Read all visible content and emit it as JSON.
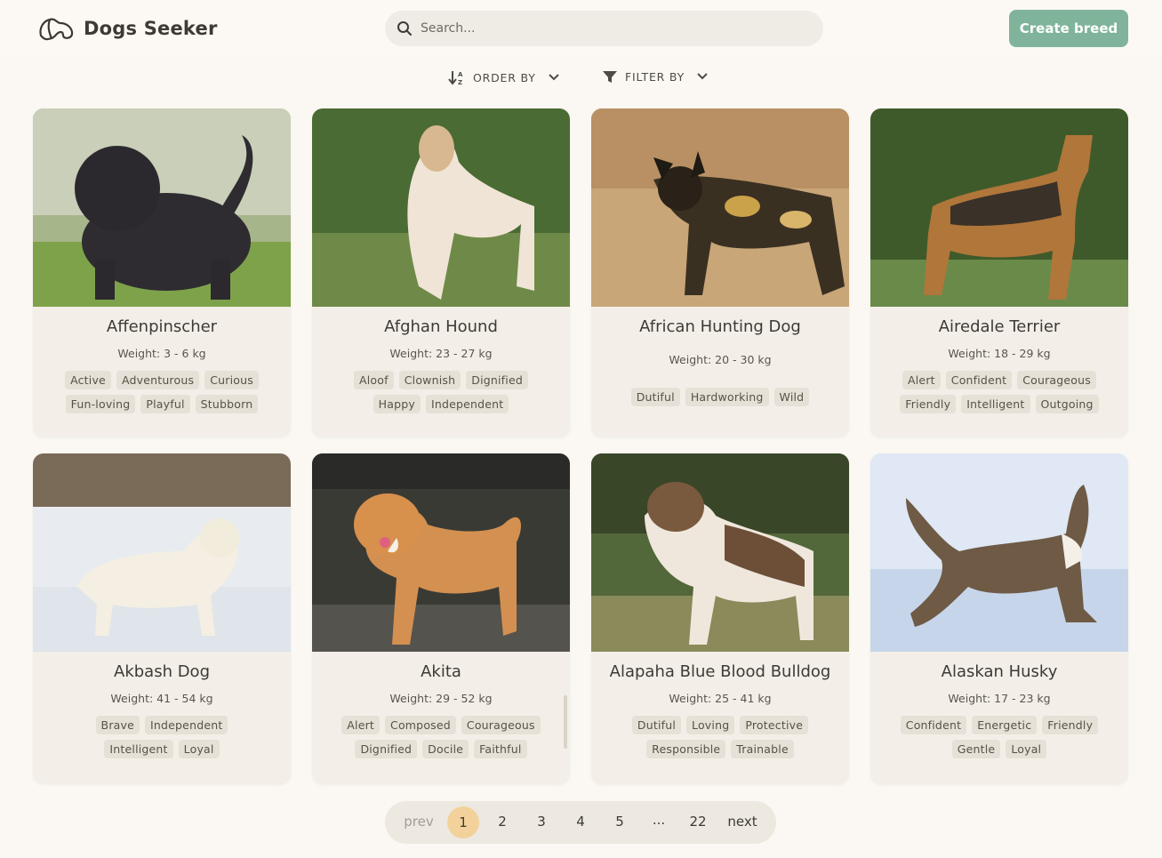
{
  "app": {
    "title": "Dogs Seeker",
    "create_label": "Create breed",
    "accent": "#7fb49a"
  },
  "search": {
    "placeholder": "Search..."
  },
  "toolbar": {
    "order_label": "ORDER BY",
    "filter_label": "FILTER BY"
  },
  "dogs": [
    {
      "name": "Affenpinscher",
      "weight": "Weight: 3 - 6 kg",
      "tags": [
        "Active",
        "Adventurous",
        "Curious",
        "Fun-loving",
        "Playful",
        "Stubborn"
      ]
    },
    {
      "name": "Afghan Hound",
      "weight": "Weight: 23 - 27 kg",
      "tags": [
        "Aloof",
        "Clownish",
        "Dignified",
        "Happy",
        "Independent"
      ]
    },
    {
      "name": "African Hunting Dog",
      "weight": "Weight: 20 - 30 kg",
      "tags": [
        "Dutiful",
        "Hardworking",
        "Wild"
      ]
    },
    {
      "name": "Airedale Terrier",
      "weight": "Weight: 18 - 29 kg",
      "tags": [
        "Alert",
        "Confident",
        "Courageous",
        "Friendly",
        "Intelligent",
        "Outgoing"
      ]
    },
    {
      "name": "Akbash Dog",
      "weight": "Weight: 41 - 54 kg",
      "tags": [
        "Brave",
        "Independent",
        "Intelligent",
        "Loyal"
      ]
    },
    {
      "name": "Akita",
      "weight": "Weight: 29 - 52 kg",
      "tags": [
        "Alert",
        "Composed",
        "Courageous",
        "Dignified",
        "Docile",
        "Faithful"
      ]
    },
    {
      "name": "Alapaha Blue Blood Bulldog",
      "weight": "Weight: 25 - 41 kg",
      "tags": [
        "Dutiful",
        "Loving",
        "Protective",
        "Responsible",
        "Trainable"
      ]
    },
    {
      "name": "Alaskan Husky",
      "weight": "Weight: 17 - 23 kg",
      "tags": [
        "Confident",
        "Energetic",
        "Friendly",
        "Gentle",
        "Loyal"
      ]
    }
  ],
  "pagination": {
    "prev": "prev",
    "pages": [
      "1",
      "2",
      "3",
      "4",
      "5",
      "...",
      "22"
    ],
    "active": "1",
    "next": "next"
  }
}
